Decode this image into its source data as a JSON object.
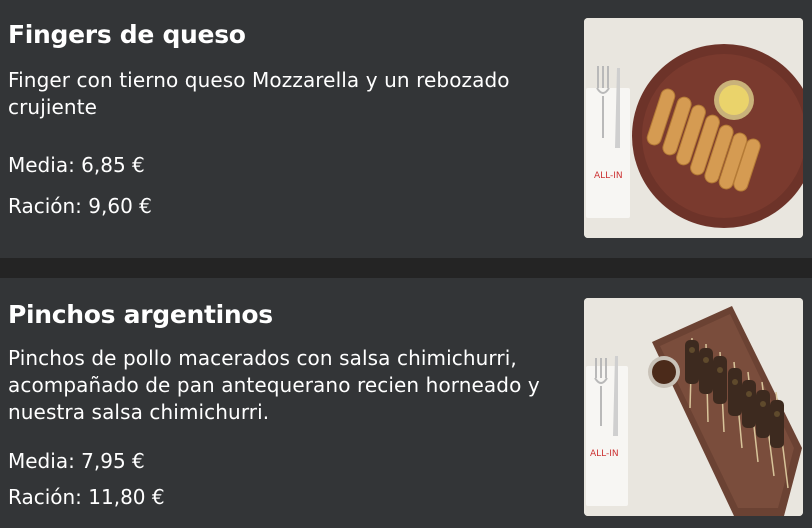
{
  "items": [
    {
      "name": "Fingers de queso",
      "description": "Finger con tierno queso Mozzarella y un rebozado crujiente",
      "prices": [
        {
          "label": "Media: 6,85 €"
        },
        {
          "label": "Ración: 9,60 €"
        }
      ],
      "image_alt": "Fingers de queso",
      "brand_mark": "ALL-IN"
    },
    {
      "name": "Pinchos argentinos",
      "description": "Pinchos de pollo macerados con salsa chimichurri, acompañado de pan antequerano recien horneado y nuestra salsa chimichurri.",
      "prices": [
        {
          "label": "Media: 7,95 €"
        },
        {
          "label": "Ración: 11,80 €"
        }
      ],
      "image_alt": "Pinchos argentinos",
      "brand_mark": "ALL-IN"
    }
  ],
  "colors": {
    "background": "#2d2f31",
    "card": "#333537",
    "separator": "#242424",
    "text": "#ffffff"
  }
}
